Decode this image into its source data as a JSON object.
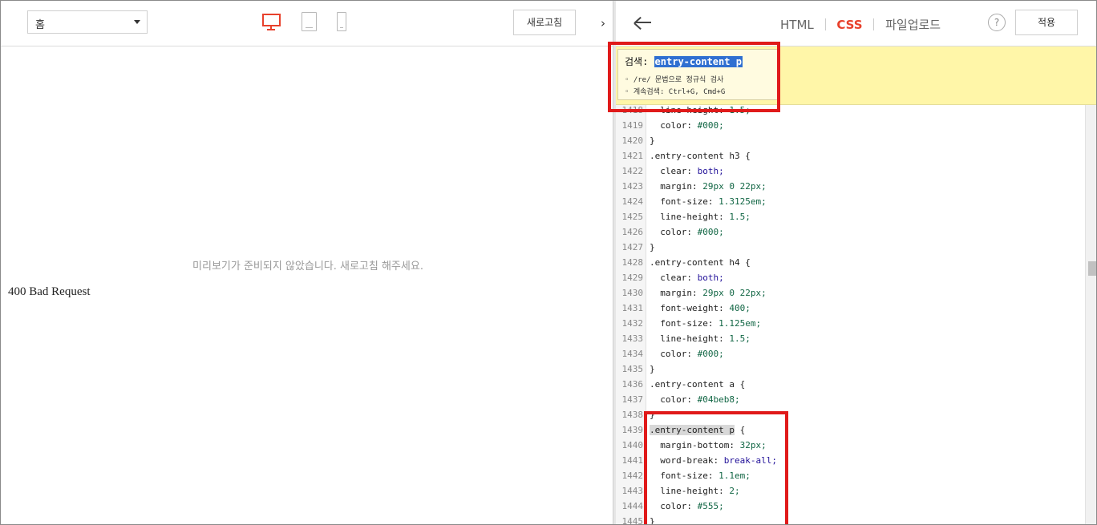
{
  "left": {
    "page_select": "홈",
    "refresh_label": "새로고침",
    "toggle_icon": "›",
    "preview_message": "미리보기가 준비되지 않았습니다. 새로고침 해주세요.",
    "error_text": "400 Bad Request"
  },
  "right": {
    "tabs": [
      {
        "label": "HTML",
        "active": false
      },
      {
        "label": "CSS",
        "active": true
      },
      {
        "label": "파일업로드",
        "active": false
      }
    ],
    "help_label": "?",
    "apply_label": "적용",
    "search": {
      "label": "검색:",
      "term": "entry-content p",
      "tips": [
        "/re/ 문법으로 정규식 검사",
        "계속검색: Ctrl+G, Cmd+G"
      ]
    },
    "code_lines": [
      {
        "n": "1418",
        "sel": "",
        "prop": "line-height",
        "val": "1.5;",
        "kw": false
      },
      {
        "n": "1419",
        "sel": "",
        "prop": "color",
        "val": "#000;",
        "kw": false
      },
      {
        "n": "1420",
        "sel": "}",
        "prop": "",
        "val": "",
        "kw": false
      },
      {
        "n": "1421",
        "sel": ".entry-content h3 {",
        "prop": "",
        "val": "",
        "kw": false
      },
      {
        "n": "1422",
        "sel": "",
        "prop": "clear",
        "val": "both;",
        "kw": true
      },
      {
        "n": "1423",
        "sel": "",
        "prop": "margin",
        "val": "29px 0 22px;",
        "kw": false
      },
      {
        "n": "1424",
        "sel": "",
        "prop": "font-size",
        "val": "1.3125em;",
        "kw": false
      },
      {
        "n": "1425",
        "sel": "",
        "prop": "line-height",
        "val": "1.5;",
        "kw": false
      },
      {
        "n": "1426",
        "sel": "",
        "prop": "color",
        "val": "#000;",
        "kw": false
      },
      {
        "n": "1427",
        "sel": "}",
        "prop": "",
        "val": "",
        "kw": false
      },
      {
        "n": "1428",
        "sel": ".entry-content h4 {",
        "prop": "",
        "val": "",
        "kw": false
      },
      {
        "n": "1429",
        "sel": "",
        "prop": "clear",
        "val": "both;",
        "kw": true
      },
      {
        "n": "1430",
        "sel": "",
        "prop": "margin",
        "val": "29px 0 22px;",
        "kw": false
      },
      {
        "n": "1431",
        "sel": "",
        "prop": "font-weight",
        "val": "400;",
        "kw": false
      },
      {
        "n": "1432",
        "sel": "",
        "prop": "font-size",
        "val": "1.125em;",
        "kw": false
      },
      {
        "n": "1433",
        "sel": "",
        "prop": "line-height",
        "val": "1.5;",
        "kw": false
      },
      {
        "n": "1434",
        "sel": "",
        "prop": "color",
        "val": "#000;",
        "kw": false
      },
      {
        "n": "1435",
        "sel": "}",
        "prop": "",
        "val": "",
        "kw": false
      },
      {
        "n": "1436",
        "sel": ".entry-content a {",
        "prop": "",
        "val": "",
        "kw": false
      },
      {
        "n": "1437",
        "sel": "",
        "prop": "color",
        "val": "#04beb8;",
        "kw": false
      },
      {
        "n": "1438",
        "sel": "}",
        "prop": "",
        "val": "",
        "kw": false
      },
      {
        "n": "1439",
        "sel": "MATCH",
        "prop": "",
        "val": "",
        "kw": false
      },
      {
        "n": "1440",
        "sel": "",
        "prop": "margin-bottom",
        "val": "32px;",
        "kw": false
      },
      {
        "n": "1441",
        "sel": "",
        "prop": "word-break",
        "val": "break-all;",
        "kw": true
      },
      {
        "n": "1442",
        "sel": "",
        "prop": "font-size",
        "val": "1.1em;",
        "kw": false
      },
      {
        "n": "1443",
        "sel": "",
        "prop": "line-height",
        "val": "2;",
        "kw": false
      },
      {
        "n": "1444",
        "sel": "",
        "prop": "color",
        "val": "#555;",
        "kw": false
      },
      {
        "n": "1445",
        "sel": "}",
        "prop": "",
        "val": "",
        "kw": false
      }
    ],
    "match_line": {
      "match": ".entry-content p",
      "rest": " {"
    }
  },
  "colors": {
    "accent": "#e8412c",
    "annotation": "#e01a1a",
    "search_bg": "#fff6a8",
    "selection": "#2f6fd1"
  }
}
